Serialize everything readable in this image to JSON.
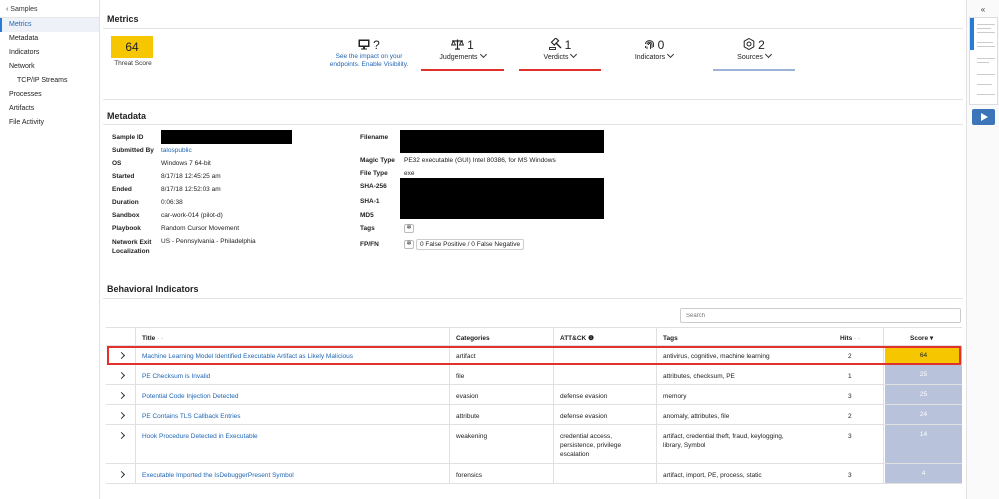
{
  "sidebar": {
    "back_label": "‹ Samples",
    "items": [
      {
        "label": "Metrics",
        "active": true,
        "sub": false
      },
      {
        "label": "Metadata",
        "active": false,
        "sub": false
      },
      {
        "label": "Indicators",
        "active": false,
        "sub": false
      },
      {
        "label": "Network",
        "active": false,
        "sub": false
      },
      {
        "label": "TCP/IP Streams",
        "active": false,
        "sub": true
      },
      {
        "label": "Processes",
        "active": false,
        "sub": false
      },
      {
        "label": "Artifacts",
        "active": false,
        "sub": false
      },
      {
        "label": "File Activity",
        "active": false,
        "sub": false
      }
    ]
  },
  "minimap": {
    "collapse_label": "«"
  },
  "metrics": {
    "title": "Metrics",
    "threat_score": "64",
    "threat_label": "Threat Score",
    "visibility": {
      "value": "?",
      "text": "See the impact on your endpoints. Enable Visibility."
    },
    "judgements": {
      "value": "1",
      "label": "Judgements"
    },
    "verdicts": {
      "value": "1",
      "label": "Verdicts"
    },
    "indicators": {
      "value": "0",
      "label": "Indicators"
    },
    "sources": {
      "value": "2",
      "label": "Sources"
    }
  },
  "metadata": {
    "title": "Metadata",
    "labels": {
      "sample_id": "Sample ID",
      "submitted_by": "Submitted By",
      "os": "OS",
      "started": "Started",
      "ended": "Ended",
      "duration": "Duration",
      "sandbox": "Sandbox",
      "playbook": "Playbook",
      "network_exit": "Network Exit Localization",
      "filename": "Filename",
      "magic_type": "Magic Type",
      "file_type": "File Type",
      "sha256": "SHA-256",
      "sha1": "SHA-1",
      "md5": "MD5",
      "tags": "Tags",
      "fpfn": "FP/FN"
    },
    "values": {
      "submitted_by": "talospublic",
      "os": "Windows 7 64-bit",
      "started": "8/17/18 12:45:25 am",
      "ended": "8/17/18 12:52:03 am",
      "duration": "0:06:38",
      "sandbox": "car-work-014 (pilot-d)",
      "playbook": "Random Cursor Movement",
      "network_exit": "US - Pennsylvania - Philadelphia",
      "magic_type": "PE32 executable (GUI) Intel 80386, for MS Windows",
      "file_type": "exe",
      "fpfn": "0 False Positive / 0 False Negative"
    }
  },
  "behavioral": {
    "title": "Behavioral Indicators",
    "search_placeholder": "Search",
    "columns": {
      "title": "Title",
      "categories": "Categories",
      "attck": "ATT&CK",
      "tags": "Tags",
      "hits": "Hits",
      "score": "Score"
    },
    "rows": [
      {
        "title": "Machine Learning Model Identified Executable Artifact as Likely Malicious",
        "category": "artifact",
        "attck": "",
        "tags": "antivirus, cognitive, machine learning",
        "hits": "2",
        "score": "64"
      },
      {
        "title": "PE Checksum is Invalid",
        "category": "file",
        "attck": "",
        "tags": "attributes, checksum, PE",
        "hits": "1",
        "score": "25"
      },
      {
        "title": "Potential Code Injection Detected",
        "category": "evasion",
        "attck": "defense evasion",
        "tags": "memory",
        "hits": "3",
        "score": "25"
      },
      {
        "title": "PE Contains TLS Callback Entries",
        "category": "attribute",
        "attck": "defense evasion",
        "tags": "anomaly, attributes, file",
        "hits": "2",
        "score": "24"
      },
      {
        "title": "Hook Procedure Detected in Executable",
        "category": "weakening",
        "attck": "credential access, persistence, privilege escalation",
        "tags": "artifact, credential theft, fraud, keylogging, library, Symbol",
        "hits": "3",
        "score": "14"
      },
      {
        "title": "Executable Imported the IsDebuggerPresent Symbol",
        "category": "forensics",
        "attck": "",
        "tags": "artifact, import, PE, process, static",
        "hits": "3",
        "score": "4"
      }
    ]
  },
  "colors": {
    "accent": "#1f66b5",
    "threat": "#f6c700",
    "alert": "#e0322a",
    "score_low": "#b8c3db",
    "sources_underline": "#9db4d8"
  }
}
